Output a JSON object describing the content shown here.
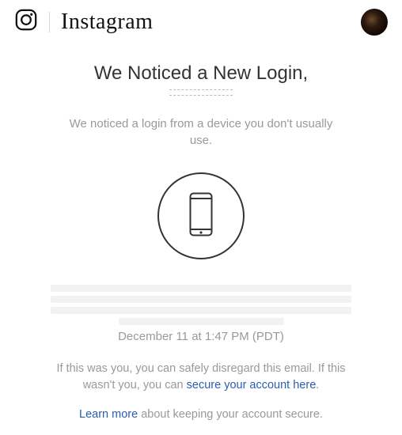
{
  "header": {
    "brand_wordmark": "Instagram"
  },
  "main": {
    "headline": "We Noticed a New Login,",
    "subhead": "We noticed a login from a device you don't usually use.",
    "device_icon_name": "phone-icon",
    "timestamp": "December 11 at 1:47 PM (PDT)",
    "para1_prefix": "If this was you, you can safely disregard this email. If this wasn't you, you can ",
    "secure_link": "secure your account here",
    "para1_suffix": ".",
    "para2_link": "Learn more",
    "para2_rest": " about keeping your account secure."
  }
}
